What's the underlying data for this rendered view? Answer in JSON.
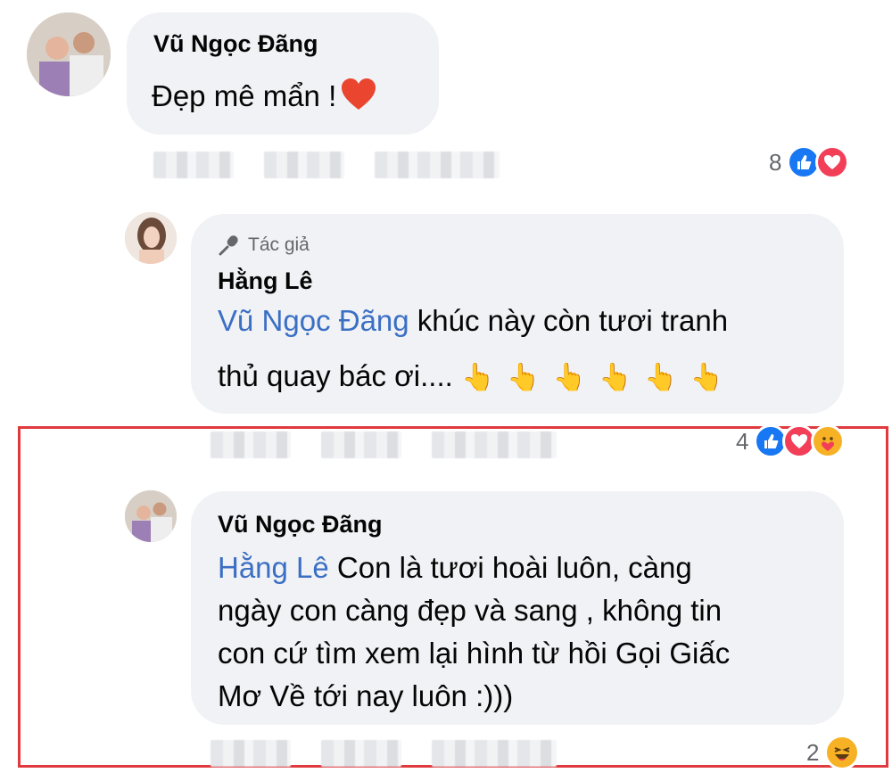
{
  "comments": [
    {
      "author": "Vũ Ngọc Đãng",
      "text": "Đẹp mê mẩn !",
      "reaction_count": "8"
    },
    {
      "author_badge": "Tác giả",
      "author": "Hằng Lê",
      "mention": "Vũ Ngọc Đãng",
      "text_line1": " khúc này còn tươi tranh",
      "text_line2": "thủ quay bác ơi....",
      "emoji": "👆",
      "reaction_count": "4"
    },
    {
      "author": "Vũ Ngọc Đãng",
      "mention": "Hằng Lê",
      "text_line1": " Con là tươi hoài luôn, càng",
      "text_line2": "ngày con càng đẹp và sang , không tin",
      "text_line3": "con cứ tìm xem lại hình từ hồi Gọi Giấc",
      "text_line4": "Mơ Về tới nay luôn :)))",
      "reaction_count": "2"
    }
  ],
  "colors": {
    "mention": "#3b6fc4",
    "bubble": "#f0f2f5",
    "highlight_border": "#e0393e",
    "like": "#1877f2",
    "love": "#f33e58"
  },
  "icons": [
    "microphone-icon",
    "like-icon",
    "love-icon",
    "care-icon",
    "haha-icon",
    "heart-emoji-icon"
  ]
}
